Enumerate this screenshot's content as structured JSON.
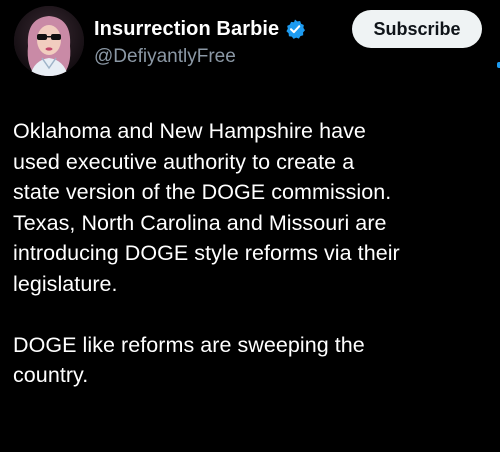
{
  "author": {
    "display_name": "Insurrection Barbie",
    "handle": "@DefiyantlyFree",
    "verified": true,
    "avatar_icon": "profile-photo"
  },
  "actions": {
    "subscribe_label": "Subscribe"
  },
  "post": {
    "paragraphs": [
      "Oklahoma and New Hampshire have\nused executive authority to create a\nstate version of the DOGE commission.\nTexas, North Carolina and Missouri are\nintroducing DOGE style reforms via their\nlegislature.",
      "DOGE like reforms are sweeping the\ncountry."
    ]
  },
  "colors": {
    "background": "#000000",
    "text_primary": "#ffffff",
    "text_secondary": "#8b98a5",
    "verified_blue": "#1d9bf0",
    "button_bg": "#eff3f4",
    "button_text": "#0f1419"
  }
}
